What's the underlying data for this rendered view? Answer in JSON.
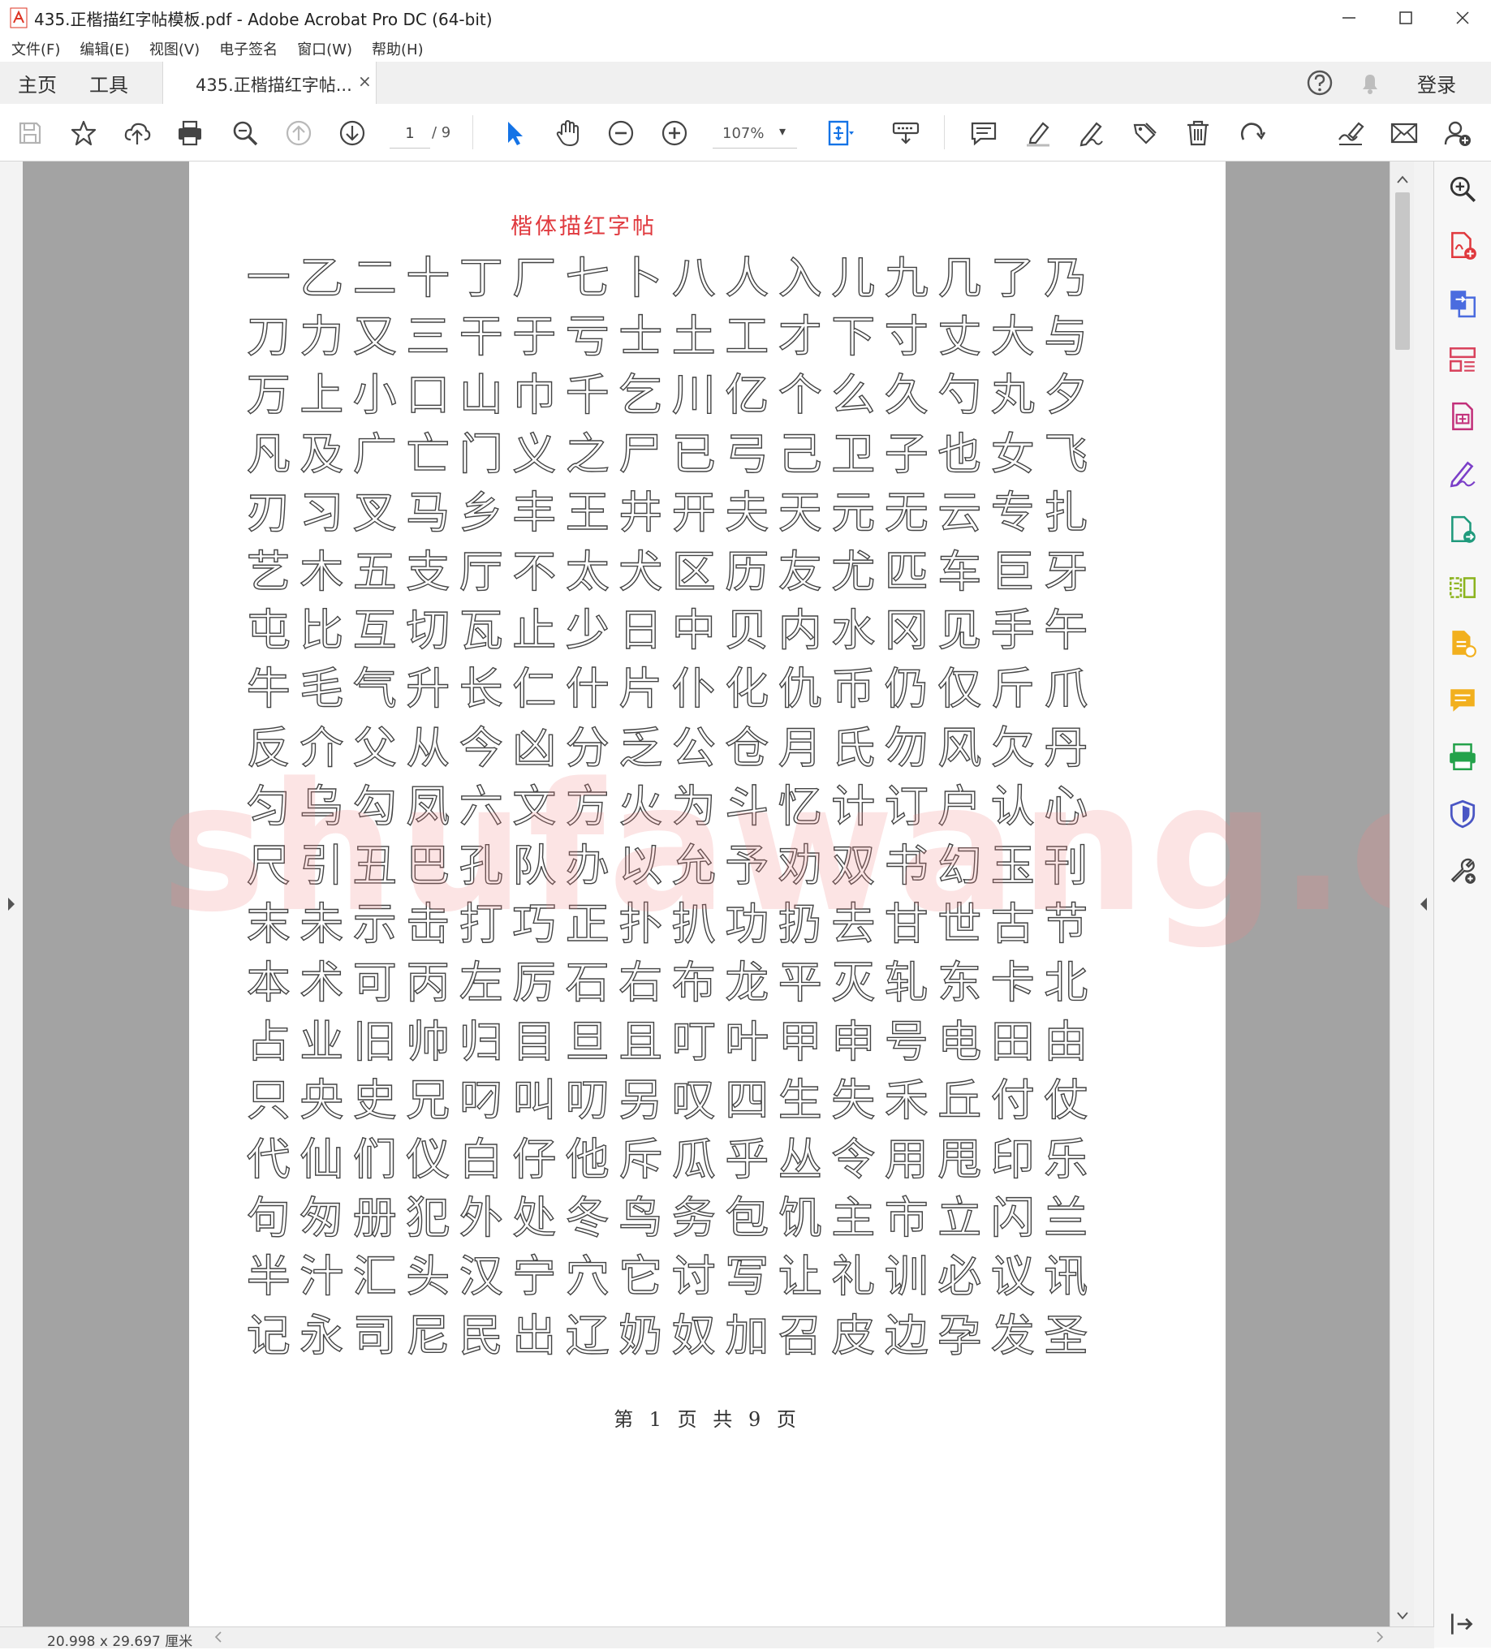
{
  "window": {
    "title": "435.正楷描红字帖模板.pdf - Adobe Acrobat Pro DC (64-bit)",
    "controls": {
      "minimize": "—",
      "maximize": "☐",
      "close": "✕"
    }
  },
  "menu": [
    "文件(F)",
    "编辑(E)",
    "视图(V)",
    "电子签名",
    "窗口(W)",
    "帮助(H)"
  ],
  "tabs": {
    "home": "主页",
    "tools": "工具",
    "document": "435.正楷描红字帖...",
    "close": "×",
    "login": "登录"
  },
  "toolbar": {
    "page_current": "1",
    "page_total": "/ 9",
    "zoom": "107%",
    "zoom_caret": "▾"
  },
  "colors": {
    "accent_blue": "#1473e6",
    "title_red": "#e0393e",
    "watermark": "#f28282"
  },
  "document": {
    "title": "楷体描红字帖",
    "chars": "一乙二十丁厂七卜八人入儿九几了乃刀力又三干于亏士土工才下寸丈大与万上小口山巾千乞川亿个么久勺丸夕凡及广亡门义之尸已弓己卫子也女飞刃习叉马乡丰王井开夫天元无云专扎艺木五支厅不太犬区历友尤匹车巨牙屯比互切瓦止少日中贝内水冈见手午牛毛气升长仁什片仆化仇币仍仅斤爪反介父从今凶分乏公仓月氏勿风欠丹匀乌勾凤六文方火为斗忆计订户认心尺引丑巴孔队办以允予劝双书幻玉刊末未示击打巧正扑扒功扔去甘世古节本术可丙左厉石右布龙平灭轧东卡北占业旧帅归目旦且叮叶甲申号电田由只央史兄叼叫叨另叹四生失禾丘付仗代仙们仪白仔他斥瓜乎丛令用甩印乐句匆册犯外处冬鸟务包饥主市立闪兰半汁汇头汉宁穴它讨写让礼训必议讯记永司尼民出辽奶奴加召皮边孕发圣",
    "watermark": "shufawang.cn",
    "footer": "第 1 页 共 9 页"
  },
  "status": {
    "page_size": "20.998 x 29.697 厘米"
  },
  "icons": {
    "toolbar": [
      "save-icon",
      "bookmark-star-icon",
      "upload-cloud-icon",
      "print-icon",
      "search-zoom-icon",
      "page-up-icon",
      "page-down-icon",
      "select-cursor-icon",
      "hand-icon",
      "zoom-out-icon",
      "zoom-in-icon",
      "fit-page-icon",
      "keyboard-icon",
      "comment-icon",
      "highlighter-icon",
      "sign-pen-icon",
      "share-tag-icon",
      "trash-icon",
      "rotate-icon",
      "link-sign-icon",
      "mail-icon",
      "add-user-icon"
    ],
    "right_panel": [
      "zoom-search-icon",
      "create-pdf-icon",
      "export-pdf-icon",
      "organize-pages-icon",
      "edit-pdf-icon",
      "fill-sign-icon",
      "send-review-icon",
      "compare-icon",
      "export-file-icon",
      "comment-icon",
      "scan-icon",
      "protect-shield-icon",
      "more-tools-icon",
      "collapse-pane-icon"
    ]
  }
}
